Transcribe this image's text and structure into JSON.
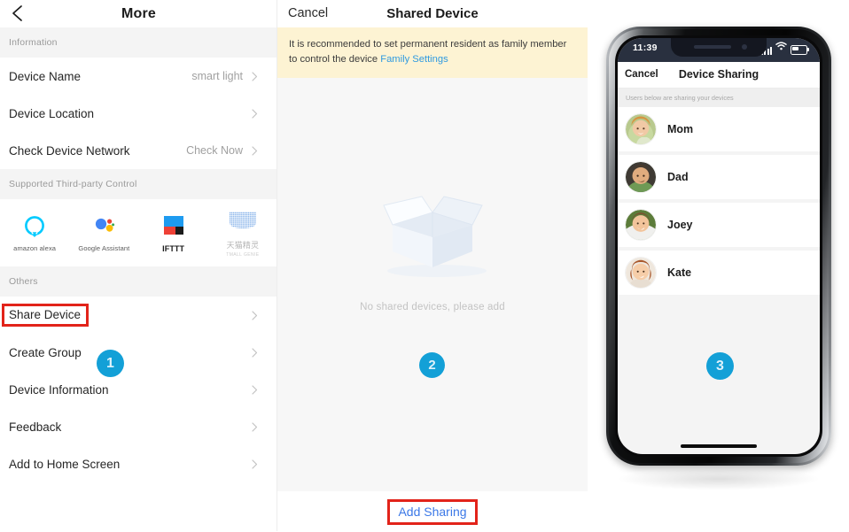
{
  "left_panel": {
    "nav": {
      "back_icon": "chevron-left-icon",
      "title": "More"
    },
    "sections": [
      {
        "header": "Information",
        "rows": [
          {
            "label": "Device Name",
            "value": "smart light"
          },
          {
            "label": "Device Location",
            "value": ""
          },
          {
            "label": "Check Device Network",
            "value": "Check Now"
          }
        ]
      },
      {
        "header": "Supported Third-party Control",
        "rows": []
      },
      {
        "header": "Others",
        "rows": [
          {
            "label": "Share Device",
            "value": ""
          },
          {
            "label": "Create Group",
            "value": ""
          },
          {
            "label": "Device Information",
            "value": ""
          },
          {
            "label": "Feedback",
            "value": ""
          },
          {
            "label": "Add to Home Screen",
            "value": ""
          }
        ]
      }
    ],
    "third_party": [
      {
        "name": "amazon alexa",
        "sub": "",
        "icon": "amazon-alexa-icon"
      },
      {
        "name": "Google Assistant",
        "sub": "",
        "icon": "google-assistant-icon"
      },
      {
        "name": "IFTTT",
        "sub": "",
        "icon": "ifttt-icon"
      },
      {
        "name": "天猫精灵",
        "sub": "TMALL GENIE",
        "icon": "tmall-genie-icon"
      }
    ]
  },
  "middle_panel": {
    "nav": {
      "cancel": "Cancel",
      "title": "Shared Device"
    },
    "tip": {
      "text": "It is recommended to set permanent resident as family member to control the device ",
      "link": "Family Settings"
    },
    "empty_state": {
      "icon": "empty-box-icon",
      "caption": "No shared devices, please add"
    },
    "add_sharing": "Add Sharing"
  },
  "phone_panel": {
    "status_bar": {
      "time": "11:39",
      "signal_icon": "signal-bars-icon",
      "wifi_icon": "wifi-icon",
      "battery_icon": "battery-icon"
    },
    "nav": {
      "cancel": "Cancel",
      "title": "Device Sharing"
    },
    "subheader": "Users below are sharing your devices",
    "users": [
      {
        "name": "Mom",
        "avatar": "avatar-mom"
      },
      {
        "name": "Dad",
        "avatar": "avatar-dad"
      },
      {
        "name": "Joey",
        "avatar": "avatar-joey"
      },
      {
        "name": "Kate",
        "avatar": "avatar-kate"
      }
    ]
  },
  "steps": [
    {
      "number": "1"
    },
    {
      "number": "2"
    },
    {
      "number": "3"
    }
  ],
  "colors": {
    "badge": "#13a0d7",
    "highlight": "#e2231a",
    "link": "#2f9ae0",
    "tip_bg": "#fdf3d3",
    "add_sharing": "#3b78e7"
  }
}
